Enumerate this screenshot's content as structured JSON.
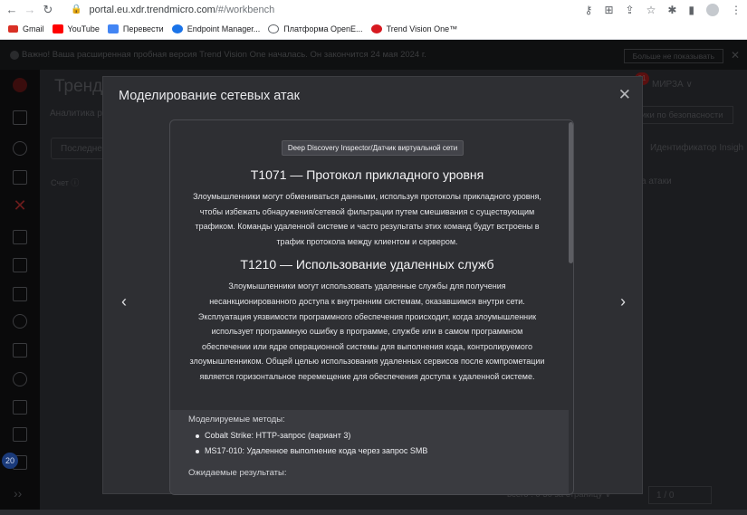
{
  "browser": {
    "url_host": "portal.eu.xdr.trendmicro.com",
    "url_path": "/#/workbench",
    "bookmarks": [
      {
        "label": "Gmail",
        "color": "#d93025"
      },
      {
        "label": "YouTube",
        "color": "#ff0000"
      },
      {
        "label": "Перевести",
        "color": "#4285f4"
      },
      {
        "label": "Endpoint Manager...",
        "color": "#1a73e8"
      },
      {
        "label": "Платформа OpenE...",
        "color": "#5f6368"
      },
      {
        "label": "Trend Vision One™",
        "color": "#d71920"
      }
    ]
  },
  "banner": {
    "text": "Важно! Ваша расширенная пробная версия Trend Vision One началась. Он закончится 24 мая 2024 г.",
    "dismiss_label": "Больше не показывать"
  },
  "background": {
    "title": "Тренд",
    "tab": "Аналитика р",
    "filter": "Последне",
    "count_label": "Счет ⓘ",
    "user": "МИРЗА ∨",
    "security_pill": "ики по безопасности",
    "identifier": "Идентификатор Insigh",
    "attack": "а атаки",
    "pager": "всего : 0     30 за страницу ∨",
    "page_box": "1 / 0",
    "notif_count": "21",
    "badge": "20"
  },
  "modal": {
    "title": "Моделирование сетевых атак",
    "sensor_tag": "Deep Discovery Inspector/Датчик виртуальной сети",
    "t1_title": "T1071 — Протокол прикладного уровня",
    "t1_body": "Злоумышленники могут обмениваться данными, используя протоколы прикладного уровня, чтобы избежать обнаружения/сетевой фильтрации путем смешивания с существующим трафиком. Команды удаленной системе и часто результаты этих команд будут встроены в трафик протокола между клиентом и сервером.",
    "t2_title": "T1210 — Использование удаленных служб",
    "t2_body": "Злоумышленники могут использовать удаленные службы для получения несанкционированного доступа к внутренним системам, оказавшимся внутри сети. Эксплуатация уязвимости программного обеспечения происходит, когда злоумышленник использует программную ошибку в программе, службе или в самом программном обеспечении или ядре операционной системы для выполнения кода, контролируемого злоумышленником. Общей целью использования удаленных сервисов после компрометации является горизонтальное перемещение для обеспечения доступа к удаленной системе.",
    "methods_label": "Моделируемые методы:",
    "methods": [
      "Cobalt Strike: HTTP-запрос (вариант 3)",
      "MS17-010: Удаленное выполнение кода через запрос SMB"
    ],
    "results_label": "Ожидаемые результаты:"
  }
}
